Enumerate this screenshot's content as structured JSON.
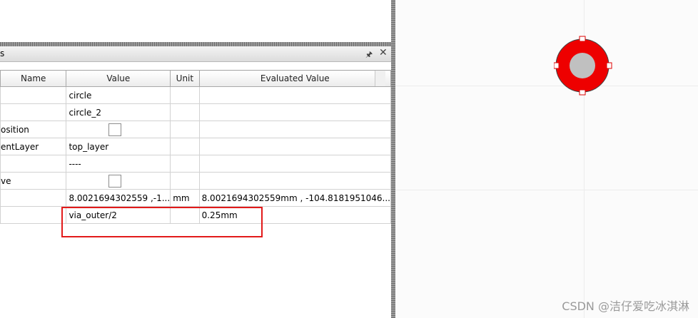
{
  "panel": {
    "title": "s",
    "columns": [
      "Name",
      "Value",
      "Unit",
      "Evaluated Value"
    ],
    "rows": [
      {
        "name": "",
        "value": "circle",
        "unit": "",
        "evaluated": "",
        "checkbox": false
      },
      {
        "name": "",
        "value": "circle_2",
        "unit": "",
        "evaluated": "",
        "checkbox": false
      },
      {
        "name": "osition",
        "value": "",
        "unit": "",
        "evaluated": "",
        "checkbox": true
      },
      {
        "name": "entLayer",
        "value": "top_layer",
        "unit": "",
        "evaluated": "",
        "checkbox": false
      },
      {
        "name": "",
        "value": "----",
        "unit": "",
        "evaluated": "",
        "checkbox": false
      },
      {
        "name": "ve",
        "value": "",
        "unit": "",
        "evaluated": "",
        "checkbox": true
      },
      {
        "name": "",
        "value": "8.0021694302559 ,-1...",
        "unit": "mm",
        "evaluated": "8.0021694302559mm , -104.8181951046...",
        "checkbox": false
      },
      {
        "name": "",
        "value": "via_outer/2",
        "unit": "",
        "evaluated": "0.25mm",
        "checkbox": false
      }
    ]
  },
  "canvas": {
    "via_outer_color": "#ee0000",
    "via_inner_color": "#c0c0c0"
  },
  "watermark": "CSDN @洁仔爱吃冰淇淋",
  "colors": {
    "highlight": "#e21a1a"
  }
}
